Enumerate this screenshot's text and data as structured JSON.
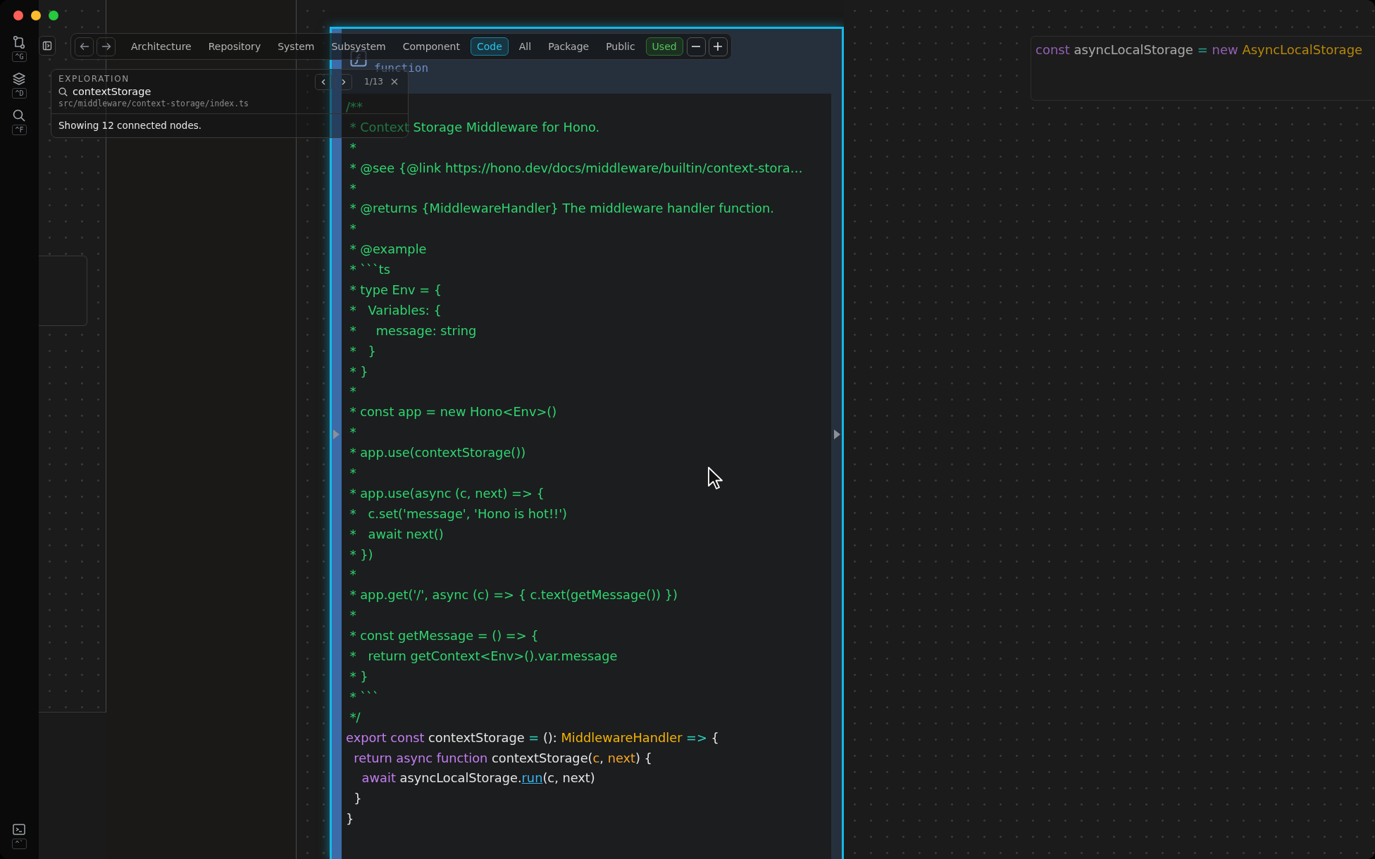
{
  "rail": {
    "items": [
      {
        "kind": "branch",
        "shortcut": "^G"
      },
      {
        "kind": "layers",
        "shortcut": "^D"
      },
      {
        "kind": "search",
        "shortcut": "^F"
      }
    ],
    "footer": {
      "kind": "terminal",
      "shortcut": "^`"
    }
  },
  "toolbar": {
    "levels": [
      {
        "label": "Architecture",
        "selected": false
      },
      {
        "label": "Repository",
        "selected": false
      },
      {
        "label": "System",
        "selected": false
      },
      {
        "label": "Subsystem",
        "selected": false
      },
      {
        "label": "Component",
        "selected": false
      },
      {
        "label": "Code",
        "selected": true
      }
    ],
    "scopes": [
      {
        "label": "All",
        "selected": false
      },
      {
        "label": "Package",
        "selected": false
      },
      {
        "label": "Public",
        "selected": false
      },
      {
        "label": "Used",
        "selected": true
      }
    ]
  },
  "exploration": {
    "heading": "EXPLORATION",
    "query": "contextStorage",
    "path": "src/middleware/context-storage/index.ts",
    "counter": "1/13",
    "status": "Showing 12 connected nodes."
  },
  "card": {
    "kind_label": "function",
    "lines": [
      [
        {
          "kind": "comment",
          "text": "/**"
        }
      ],
      [
        {
          "kind": "comment",
          "text": " * Context Storage Middleware for Hono."
        }
      ],
      [
        {
          "kind": "comment",
          "text": " *"
        }
      ],
      [
        {
          "kind": "comment",
          "text": " * @see {@link https://hono.dev/docs/middleware/builtin/context-stora…"
        }
      ],
      [
        {
          "kind": "comment",
          "text": " *"
        }
      ],
      [
        {
          "kind": "comment",
          "text": " * @returns {MiddlewareHandler} The middleware handler function."
        }
      ],
      [
        {
          "kind": "comment",
          "text": " *"
        }
      ],
      [
        {
          "kind": "comment",
          "text": " * @example"
        }
      ],
      [
        {
          "kind": "comment",
          "text": " * ```ts"
        }
      ],
      [
        {
          "kind": "comment",
          "text": " * type Env = {"
        }
      ],
      [
        {
          "kind": "comment",
          "text": " *   Variables: {"
        }
      ],
      [
        {
          "kind": "comment",
          "text": " *     message: string"
        }
      ],
      [
        {
          "kind": "comment",
          "text": " *   }"
        }
      ],
      [
        {
          "kind": "comment",
          "text": " * }"
        }
      ],
      [
        {
          "kind": "comment",
          "text": " *"
        }
      ],
      [
        {
          "kind": "comment",
          "text": " * const app = new Hono<Env>()"
        }
      ],
      [
        {
          "kind": "comment",
          "text": " *"
        }
      ],
      [
        {
          "kind": "comment",
          "text": " * app.use(contextStorage())"
        }
      ],
      [
        {
          "kind": "comment",
          "text": " *"
        }
      ],
      [
        {
          "kind": "comment",
          "text": " * app.use(async (c, next) => {"
        }
      ],
      [
        {
          "kind": "comment",
          "text": " *   c.set('message', 'Hono is hot!!')"
        }
      ],
      [
        {
          "kind": "comment",
          "text": " *   await next()"
        }
      ],
      [
        {
          "kind": "comment",
          "text": " * })"
        }
      ],
      [
        {
          "kind": "comment",
          "text": " *"
        }
      ],
      [
        {
          "kind": "comment",
          "text": " * app.get('/', async (c) => { c.text(getMessage()) })"
        }
      ],
      [
        {
          "kind": "comment",
          "text": " *"
        }
      ],
      [
        {
          "kind": "comment",
          "text": " * const getMessage = () => {"
        }
      ],
      [
        {
          "kind": "comment",
          "text": " *   return getContext<Env>().var.message"
        }
      ],
      [
        {
          "kind": "comment",
          "text": " * }"
        }
      ],
      [
        {
          "kind": "comment",
          "text": " * ```"
        }
      ],
      [
        {
          "kind": "comment",
          "text": " */"
        }
      ],
      [
        {
          "kind": "keyword",
          "text": "export const"
        },
        {
          "kind": "plain",
          "text": " contextStorage "
        },
        {
          "kind": "op",
          "text": "="
        },
        {
          "kind": "plain",
          "text": " (): "
        },
        {
          "kind": "type",
          "text": "MiddlewareHandler"
        },
        {
          "kind": "op",
          "text": " =>"
        },
        {
          "kind": "plain",
          "text": " {"
        }
      ],
      [
        {
          "kind": "keyword",
          "text": "  return async function"
        },
        {
          "kind": "plain",
          "text": " contextStorage("
        },
        {
          "kind": "param",
          "text": "c"
        },
        {
          "kind": "plain",
          "text": ", "
        },
        {
          "kind": "param",
          "text": "next"
        },
        {
          "kind": "plain",
          "text": ") {"
        }
      ],
      [
        {
          "kind": "keyword",
          "text": "    await"
        },
        {
          "kind": "plain",
          "text": " asyncLocalStorage."
        },
        {
          "kind": "link",
          "text": "run"
        },
        {
          "kind": "plain",
          "text": "(c, next)"
        }
      ],
      [
        {
          "kind": "plain",
          "text": "  }"
        }
      ],
      [
        {
          "kind": "plain",
          "text": "}"
        }
      ]
    ]
  },
  "snippet": [
    {
      "kind": "keyword",
      "text": "const"
    },
    {
      "kind": "plain",
      "text": " asyncLocalStorage "
    },
    {
      "kind": "op",
      "text": "="
    },
    {
      "kind": "keyword",
      "text": " new"
    },
    {
      "kind": "type",
      "text": " AsyncLocalStorage"
    }
  ]
}
